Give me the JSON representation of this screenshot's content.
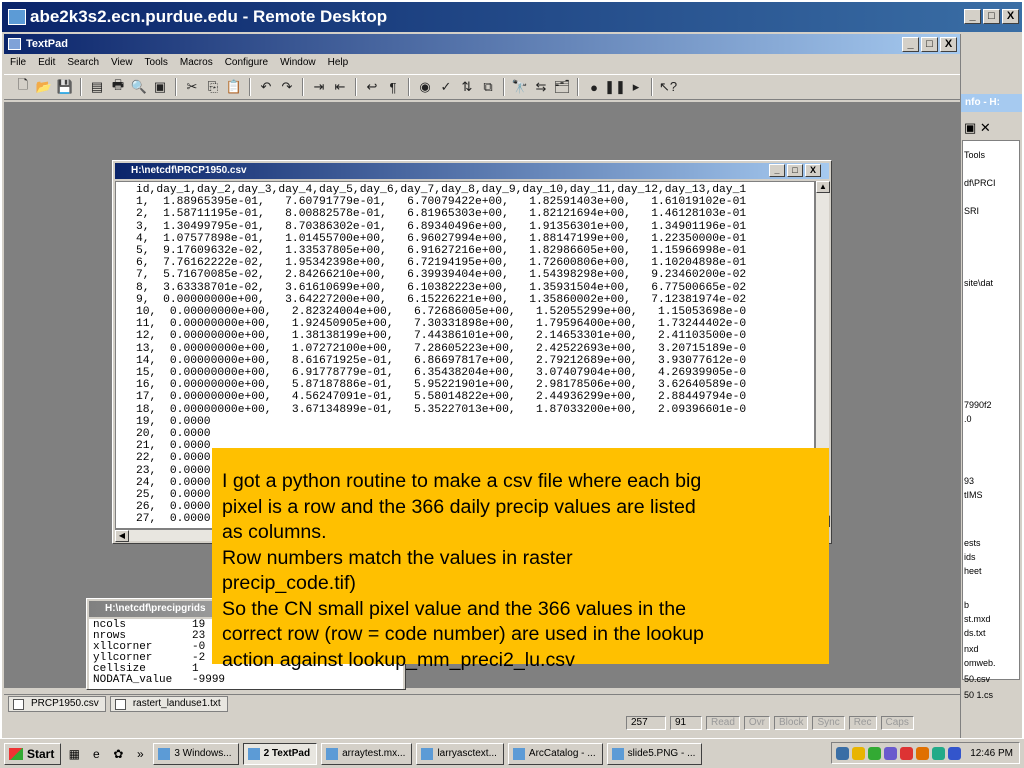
{
  "remote_desktop": {
    "title": "abe2k3s2.ecn.purdue.edu - Remote Desktop",
    "btn_min": "_",
    "btn_max": "□",
    "btn_close": "X"
  },
  "textpad": {
    "title": "TextPad",
    "menu": [
      "File",
      "Edit",
      "Search",
      "View",
      "Tools",
      "Macros",
      "Configure",
      "Window",
      "Help"
    ],
    "btn_min": "_",
    "btn_max": "□",
    "btn_close": "X"
  },
  "csv_window": {
    "title": "H:\\netcdf\\PRCP1950.csv",
    "lines": [
      "id,day_1,day_2,day_3,day_4,day_5,day_6,day_7,day_8,day_9,day_10,day_11,day_12,day_13,day_1",
      "1,  1.88965395e-01,   7.60791779e-01,   6.70079422e+00,   1.82591403e+00,   1.61019102e-01",
      "2,  1.58711195e-01,   8.00882578e-01,   6.81965303e+00,   1.82121694e+00,   1.46128103e-01",
      "3,  1.30499795e-01,   8.70386302e-01,   6.89340496e+00,   1.91356301e+00,   1.34901196e-01",
      "4,  1.07577898e-01,   1.01455700e+00,   6.96027994e+00,   1.88147199e+00,   1.22350000e-01",
      "5,  9.17609632e-02,   1.33537805e+00,   6.91627216e+00,   1.82986605e+00,   1.15966998e-01",
      "6,  7.76162222e-02,   1.95342398e+00,   6.72194195e+00,   1.72600806e+00,   1.10204898e-01",
      "7,  5.71670085e-02,   2.84266210e+00,   6.39939404e+00,   1.54398298e+00,   9.23460200e-02",
      "8,  3.63338701e-02,   3.61610699e+00,   6.10382223e+00,   1.35931504e+00,   6.77500665e-02",
      "9,  0.00000000e+00,   3.64227200e+00,   6.15226221e+00,   1.35860002e+00,   7.12381974e-02",
      "10,  0.00000000e+00,   2.82324004e+00,   6.72686005e+00,   1.52055299e+00,   1.15053698e-0",
      "11,  0.00000000e+00,   1.92450905e+00,   7.30331898e+00,   1.79596400e+00,   1.73244402e-0",
      "12,  0.00000000e+00,   1.38138199e+00,   7.44386101e+00,   2.14653301e+00,   2.41103500e-0",
      "13,  0.00000000e+00,   1.07272100e+00,   7.28605223e+00,   2.42522693e+00,   3.20715189e-0",
      "14,  0.00000000e+00,   8.61671925e-01,   6.86697817e+00,   2.79212689e+00,   3.93077612e-0",
      "15,  0.00000000e+00,   6.91778779e-01,   6.35438204e+00,   3.07407904e+00,   4.26939905e-0",
      "16,  0.00000000e+00,   5.87187886e-01,   5.95221901e+00,   2.98178506e+00,   3.62640589e-0",
      "17,  0.00000000e+00,   4.56247091e-01,   5.58014822e+00,   2.44936299e+00,   2.88449794e-0",
      "18,  0.00000000e+00,   3.67134899e-01,   5.35227013e+00,   1.87033200e+00,   2.09396601e-0",
      "19,  0.0000",
      "20,  0.0000",
      "21,  0.0000",
      "22,  0.0000",
      "23,  0.0000",
      "24,  0.0000",
      "25,  0.0000",
      "26,  0.0000",
      "27,  0.0000"
    ]
  },
  "grid_window": {
    "title": "H:\\netcdf\\precipgrids",
    "lines": [
      "ncols          19",
      "nrows          23",
      "xllcorner      -0",
      "yllcorner      -2",
      "cellsize       1",
      "NODATA_value   -9999"
    ]
  },
  "right_panel": {
    "title": "nfo - H:",
    "items": [
      "Tools",
      "df\\PRCI",
      "SRI",
      "site\\dat",
      "7990f2",
      ".0",
      "93",
      "tIMS",
      "ests",
      "ids",
      "heet",
      "b",
      "st.mxd",
      "ds.txt",
      "nxd",
      "omweb.",
      "50.csv",
      "50 1.cs"
    ]
  },
  "doc_tabs": [
    "PRCP1950.csv",
    "rastert_landuse1.txt"
  ],
  "status": {
    "line": "257",
    "col": "91",
    "flags": [
      "Read",
      "Ovr",
      "Block",
      "Sync",
      "Rec",
      "Caps"
    ]
  },
  "taskbar": {
    "start": "Start",
    "tasks": [
      "3 Windows...",
      "2 TextPad",
      "arraytest.mx...",
      "larryasctext...",
      "ArcCatalog - ...",
      "slide5.PNG - ..."
    ],
    "clock": "12:46 PM"
  },
  "callout": {
    "lines": [
      "I got a python routine to make a csv file where each big",
      "pixel is a row and the 366 daily precip values are listed",
      "as columns.",
      "Row numbers match the values in raster",
      "precip_code.tif)",
      "So the CN small pixel value and the 366 values in the",
      "correct row (row = code number) are used in the lookup",
      "action against lookup_mm_preci2_lu.csv"
    ]
  }
}
